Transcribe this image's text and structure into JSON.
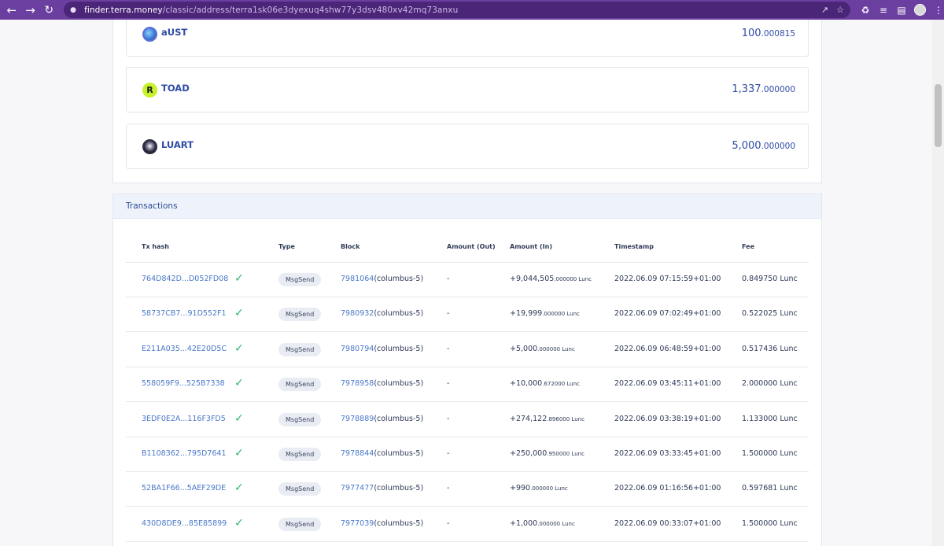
{
  "browser": {
    "url_host": "finder.terra.money",
    "url_path": "/classic/address/terra1sk06e3dyexuq4shw77y3dsv480xv42mq73anxu"
  },
  "tokens": [
    {
      "name": "aUST",
      "amount_int": "100",
      "amount_dec": ".000815",
      "icon": "aust-token-icon"
    },
    {
      "name": "TOAD",
      "amount_int": "1,337",
      "amount_dec": ".000000",
      "icon": "toad-token-icon",
      "icon_letter": "R"
    },
    {
      "name": "LUART",
      "amount_int": "5,000",
      "amount_dec": ".000000",
      "icon": "luart-token-icon"
    }
  ],
  "transactions": {
    "title": "Transactions",
    "columns": {
      "tx_hash": "Tx hash",
      "type": "Type",
      "block": "Block",
      "amount_out": "Amount (Out)",
      "amount_in": "Amount (In)",
      "timestamp": "Timestamp",
      "fee": "Fee"
    },
    "rows": [
      {
        "hash": "764D842D...D052FD08",
        "type": "MsgSend",
        "block": "7981064",
        "chain": "(columbus-5)",
        "amount_out": "-",
        "amount_in_int": "+9,044,505",
        "amount_in_dec": ".000000 Lunc",
        "timestamp": "2022.06.09 07:15:59+01:00",
        "fee": "0.849750 Lunc"
      },
      {
        "hash": "58737CB7...91D552F1",
        "type": "MsgSend",
        "block": "7980932",
        "chain": "(columbus-5)",
        "amount_out": "-",
        "amount_in_int": "+19,999",
        "amount_in_dec": ".000000 Lunc",
        "timestamp": "2022.06.09 07:02:49+01:00",
        "fee": "0.522025 Lunc"
      },
      {
        "hash": "E211A035...42E20D5C",
        "type": "MsgSend",
        "block": "7980794",
        "chain": "(columbus-5)",
        "amount_out": "-",
        "amount_in_int": "+5,000",
        "amount_in_dec": ".000000 Lunc",
        "timestamp": "2022.06.09 06:48:59+01:00",
        "fee": "0.517436 Lunc"
      },
      {
        "hash": "558059F9...525B7338",
        "type": "MsgSend",
        "block": "7978958",
        "chain": "(columbus-5)",
        "amount_out": "-",
        "amount_in_int": "+10,000",
        "amount_in_dec": ".672000 Lunc",
        "timestamp": "2022.06.09 03:45:11+01:00",
        "fee": "2.000000 Lunc"
      },
      {
        "hash": "3EDF0E2A...116F3FD5",
        "type": "MsgSend",
        "block": "7978889",
        "chain": "(columbus-5)",
        "amount_out": "-",
        "amount_in_int": "+274,122",
        "amount_in_dec": ".896000 Lunc",
        "timestamp": "2022.06.09 03:38:19+01:00",
        "fee": "1.133000 Lunc"
      },
      {
        "hash": "B1108362...795D7641",
        "type": "MsgSend",
        "block": "7978844",
        "chain": "(columbus-5)",
        "amount_out": "-",
        "amount_in_int": "+250,000",
        "amount_in_dec": ".950000 Lunc",
        "timestamp": "2022.06.09 03:33:45+01:00",
        "fee": "1.500000 Lunc"
      },
      {
        "hash": "52BA1F66...5AEF29DE",
        "type": "MsgSend",
        "block": "7977477",
        "chain": "(columbus-5)",
        "amount_out": "-",
        "amount_in_int": "+990",
        "amount_in_dec": ".000000 Lunc",
        "timestamp": "2022.06.09 01:16:56+01:00",
        "fee": "0.597681 Lunc"
      },
      {
        "hash": "430D8DE9...85E85899",
        "type": "MsgSend",
        "block": "7977039",
        "chain": "(columbus-5)",
        "amount_out": "-",
        "amount_in_int": "+1,000",
        "amount_in_dec": ".000000 Lunc",
        "timestamp": "2022.06.09 00:33:07+01:00",
        "fee": "1.500000 Lunc"
      }
    ]
  }
}
